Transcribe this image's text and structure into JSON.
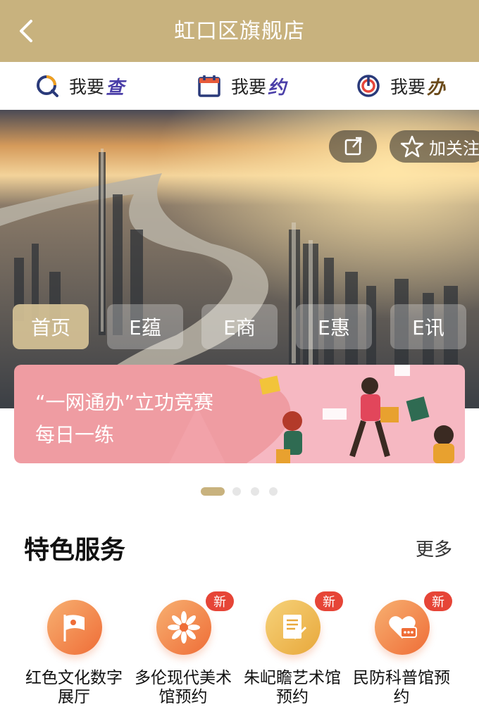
{
  "header": {
    "title": "虹口区旗舰店"
  },
  "quick_actions": [
    {
      "prefix": "我要",
      "suffix": "查",
      "icon": "search-icon",
      "color": "#4b3fa8"
    },
    {
      "prefix": "我要",
      "suffix": "约",
      "icon": "calendar-icon",
      "color": "#4b3fa8"
    },
    {
      "prefix": "我要",
      "suffix": "办",
      "icon": "target-icon",
      "color": "#6b4a1a"
    }
  ],
  "banner": {
    "follow_label": "加关注",
    "tabs": [
      "首页",
      "E蕴",
      "E商",
      "E惠",
      "E讯"
    ],
    "promo": {
      "line1": "“一网通办”立功竞赛",
      "line2": "每日一练"
    }
  },
  "carousel": {
    "count": 4,
    "active": 0
  },
  "featured": {
    "title": "特色服务",
    "more": "更多",
    "items": [
      {
        "label1": "红色文化数字",
        "label2": "展厅",
        "icon": "flag-icon",
        "badge": ""
      },
      {
        "label1": "多伦现代美术",
        "label2": "馆预约",
        "icon": "flower-icon",
        "badge": "新"
      },
      {
        "label1": "朱屺瞻艺术馆",
        "label2": "预约",
        "icon": "document-icon",
        "badge": "新"
      },
      {
        "label1": "民防科普馆预",
        "label2": "约",
        "icon": "heart-chat-icon",
        "badge": "新"
      }
    ]
  },
  "colors": {
    "header_bg": "#c8b27e",
    "accent_orange": "#ef6d37",
    "badge_red": "#e64537",
    "promo_pink": "#ef9ca2"
  }
}
